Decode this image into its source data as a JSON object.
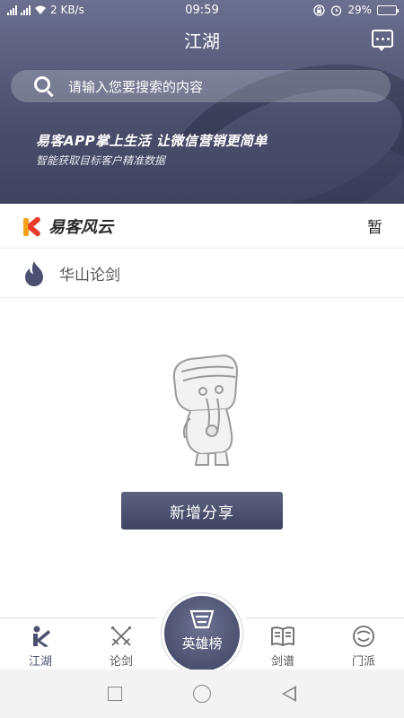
{
  "status_bar": {
    "network_left": "4G",
    "network_right": "4G",
    "speed": "2 KB/s",
    "time": "09:59",
    "battery": "29%",
    "battery_level": 0.29
  },
  "header": {
    "title": "江湖",
    "search_placeholder": "请输入您要搜索的内容",
    "promo_title": "易客APP掌上生活  让微信营销更简单",
    "promo_subtitle": "智能获取目标客户精准数据"
  },
  "brand": {
    "name": "易客风云",
    "right_text": "暂"
  },
  "section": {
    "title": "华山论剑"
  },
  "empty": {
    "share_button": "新增分享"
  },
  "tabs": [
    {
      "label": "江湖",
      "icon": "k-logo-icon"
    },
    {
      "label": "论剑",
      "icon": "crossed-swords-icon"
    },
    {
      "label": "英雄榜",
      "icon": "ranking-icon"
    },
    {
      "label": "剑谱",
      "icon": "book-icon"
    },
    {
      "label": "门派",
      "icon": "face-icon"
    }
  ],
  "colors": {
    "header_top": "#6b7090",
    "header_bottom": "#3e4360",
    "accent": "#4b5070",
    "brand_orange": "#f3a21a",
    "brand_red": "#e83a2a"
  }
}
